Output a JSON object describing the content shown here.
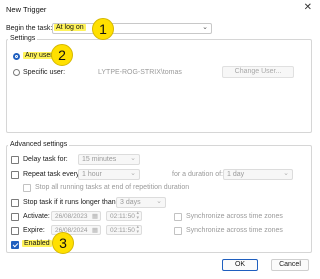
{
  "window": {
    "title": "New Trigger",
    "close_glyph": "✕"
  },
  "begin_task": {
    "label": "Begin the task:",
    "value": "At log on"
  },
  "settings": {
    "legend": "Settings",
    "any_user": "Any user",
    "specific_user": "Specific user:",
    "user_value": "LYTPE-ROG-STRIX\\tomas",
    "change_user_button": "Change User..."
  },
  "advanced": {
    "legend": "Advanced settings",
    "delay_label": "Delay task for:",
    "delay_value": "15 minutes",
    "repeat_label": "Repeat task every:",
    "repeat_value": "1 hour",
    "duration_label": "for a duration of:",
    "duration_value": "1 day",
    "stop_all_label": "Stop all running tasks at end of repetition duration",
    "stop_longer_label": "Stop task if it runs longer than:",
    "stop_longer_value": "3 days",
    "activate_label": "Activate:",
    "activate_date": "26/08/2023",
    "activate_time": "02:11:50",
    "expire_label": "Expire:",
    "expire_date": "26/08/2024",
    "expire_time": "02:11:50",
    "sync_label": "Synchronize across time zones",
    "enabled_label": "Enabled"
  },
  "buttons": {
    "ok": "OK",
    "cancel": "Cancel"
  },
  "annotations": {
    "one": "1",
    "two": "2",
    "three": "3"
  },
  "colors": {
    "accent": "#1f5fbf",
    "highlight": "#fff35a",
    "badge": "#ffe000"
  },
  "state": {
    "any_user_selected": true,
    "enabled_checked": true
  }
}
